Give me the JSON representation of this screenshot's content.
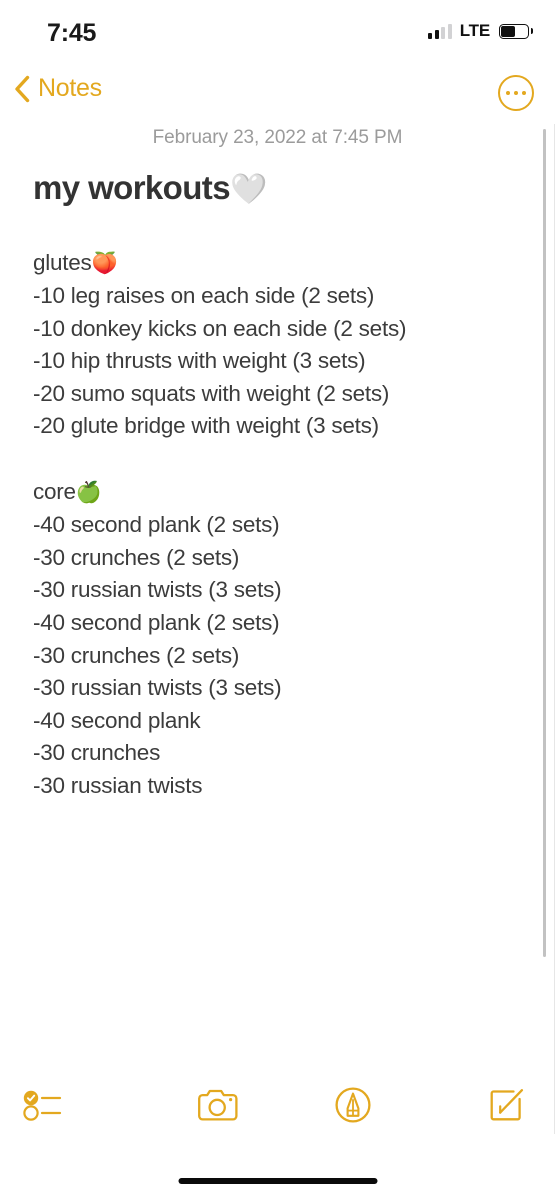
{
  "status_bar": {
    "time": "7:45",
    "carrier": "LTE",
    "signal_bars_total": 4,
    "signal_bars_filled": 2,
    "battery_percent": 55,
    "signal_icon": "cellular-signal-icon",
    "battery_icon": "battery-icon"
  },
  "nav_bar": {
    "back_label": "Notes",
    "back_icon": "chevron-left-icon",
    "more_icon": "more-ellipsis-icon",
    "accent_color": "#E3A81F"
  },
  "note": {
    "date": "February 23, 2022 at 7:45 PM",
    "title": "my workouts",
    "title_emoji": "🤍",
    "date_color": "#9b9b9b",
    "title_color": "#333333",
    "body_color": "#3c3c3c",
    "lines": [
      {
        "text": "glutes",
        "emoji": "🍑"
      },
      {
        "text": "-10 leg raises on each side (2 sets)",
        "emoji": ""
      },
      {
        "text": "-10 donkey kicks on each side (2 sets)",
        "emoji": ""
      },
      {
        "text": "-10 hip thrusts with weight (3 sets)",
        "emoji": ""
      },
      {
        "text": "-20 sumo squats with weight (2 sets)",
        "emoji": ""
      },
      {
        "text": "-20 glute bridge with weight (3 sets)",
        "emoji": ""
      },
      {
        "text": "",
        "emoji": ""
      },
      {
        "text": "core",
        "emoji": "🍏"
      },
      {
        "text": "-40 second plank (2 sets)",
        "emoji": ""
      },
      {
        "text": "-30 crunches (2 sets)",
        "emoji": ""
      },
      {
        "text": "-30 russian twists (3 sets)",
        "emoji": ""
      },
      {
        "text": "-40 second plank (2 sets)",
        "emoji": ""
      },
      {
        "text": "-30 crunches (2 sets)",
        "emoji": ""
      },
      {
        "text": "-30 russian twists (3 sets)",
        "emoji": ""
      },
      {
        "text": "-40 second plank",
        "emoji": ""
      },
      {
        "text": "-30 crunches",
        "emoji": ""
      },
      {
        "text": "-30 russian twists",
        "emoji": ""
      }
    ]
  },
  "toolbar": {
    "items": [
      {
        "name": "checklist",
        "icon": "checklist-icon"
      },
      {
        "name": "camera",
        "icon": "camera-icon"
      },
      {
        "name": "markup",
        "icon": "markup-pen-icon"
      },
      {
        "name": "compose",
        "icon": "compose-icon"
      }
    ],
    "accent_color": "#E3A81F"
  },
  "home_indicator": {
    "icon": "home-indicator-bar"
  }
}
